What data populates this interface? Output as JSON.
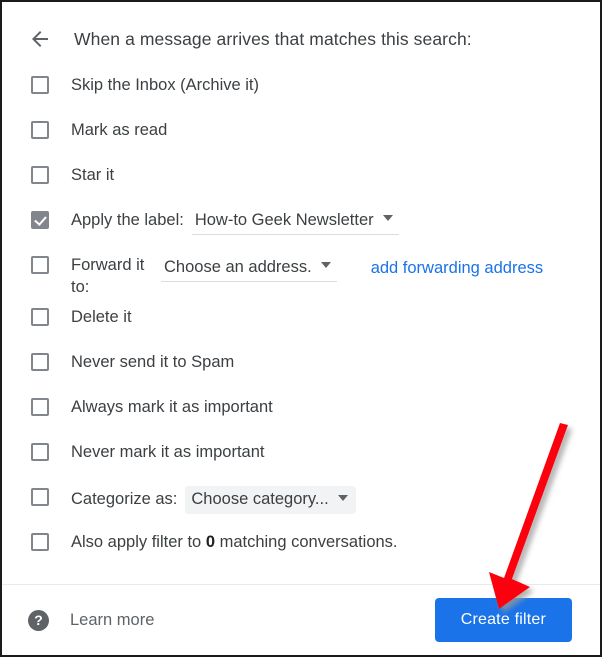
{
  "header": {
    "back_icon": "back-arrow-icon",
    "title": "When a message arrives that matches this search:"
  },
  "options": [
    {
      "id": "skip-inbox",
      "label": "Skip the Inbox (Archive it)",
      "checked": false
    },
    {
      "id": "mark-as-read",
      "label": "Mark as read",
      "checked": false
    },
    {
      "id": "star-it",
      "label": "Star it",
      "checked": false
    },
    {
      "id": "apply-label",
      "label": "Apply the label:",
      "checked": true,
      "dropdown": {
        "value": "How-to Geek Newsletter",
        "style": "underline"
      }
    },
    {
      "id": "forward-it",
      "label": "Forward it to:",
      "checked": false,
      "dropdown": {
        "value": "Choose an address.",
        "style": "underline"
      },
      "link": "add forwarding address"
    },
    {
      "id": "delete-it",
      "label": "Delete it",
      "checked": false
    },
    {
      "id": "never-spam",
      "label": "Never send it to Spam",
      "checked": false
    },
    {
      "id": "always-important",
      "label": "Always mark it as important",
      "checked": false
    },
    {
      "id": "never-important",
      "label": "Never mark it as important",
      "checked": false
    },
    {
      "id": "categorize-as",
      "label": "Categorize as:",
      "checked": false,
      "dropdown": {
        "value": "Choose category...",
        "style": "shaded"
      }
    },
    {
      "id": "also-apply",
      "label_pre": "Also apply filter to ",
      "label_bold": "0",
      "label_post": " matching conversations.",
      "checked": false
    }
  ],
  "footer": {
    "help_icon": "help-circle-icon",
    "learn_more": "Learn more",
    "create_button": "Create filter"
  },
  "annotation": {
    "arrow_color": "#fb0007",
    "arrow_shadow": "#b9b9b9"
  },
  "colors": {
    "accent_blue": "#1a73e8",
    "link_blue": "#1a73e8",
    "text": "#3c4043",
    "muted": "#5f6368",
    "checkbox_border": "#80868b",
    "checkbox_checked": "#80868b",
    "dropdown_shade": "#f1f3f4",
    "divider": "#e8eaed",
    "frame": "#1b1b1b"
  }
}
